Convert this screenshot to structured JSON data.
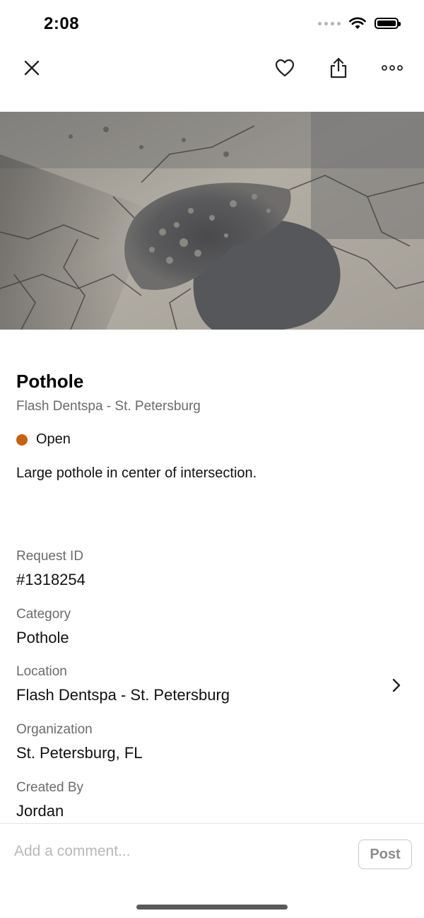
{
  "status_bar": {
    "time": "2:08"
  },
  "nav": {
    "icons": [
      "close-icon",
      "heart-icon",
      "share-icon",
      "more-icon"
    ]
  },
  "request": {
    "title": "Pothole",
    "location_line": "Flash Dentspa - St. Petersburg",
    "status": "Open",
    "status_color": "#c9610c",
    "description": "Large pothole in center of intersection."
  },
  "details": {
    "request_id_label": "Request ID",
    "request_id_value": "#1318254",
    "category_label": "Category",
    "category_value": "Pothole",
    "location_label": "Location",
    "location_value": "Flash Dentspa - St. Petersburg",
    "organization_label": "Organization",
    "organization_value": "St. Petersburg, FL",
    "created_by_label": "Created By",
    "created_by_value": "Jordan"
  },
  "comment": {
    "placeholder": "Add a comment...",
    "post_label": "Post"
  }
}
